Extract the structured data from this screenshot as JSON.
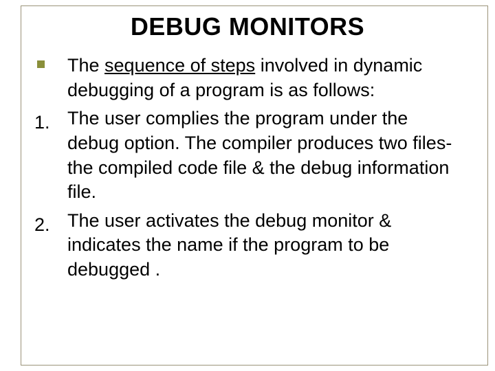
{
  "title": "DEBUG MONITORS",
  "items": {
    "intro": {
      "pre": "The ",
      "underlined": "sequence of steps",
      "post": " involved in dynamic debugging of a program is as follows:"
    },
    "step1": {
      "num": "1.",
      "text": "The user complies the program under the debug option. The compiler produces two files- the compiled code file & the debug information file."
    },
    "step2": {
      "num": "2.",
      "text": "The user activates the debug monitor & indicates the name if the program to be debugged ."
    }
  }
}
